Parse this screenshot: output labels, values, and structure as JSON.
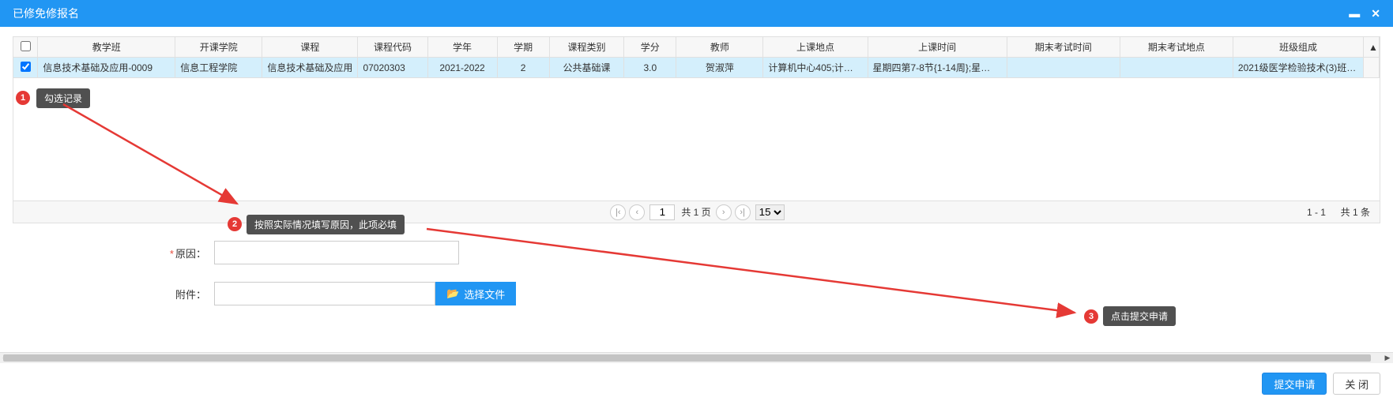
{
  "titlebar": {
    "title": "已修免修报名",
    "minimize_icon": "minimize-icon",
    "close_icon": "close-icon"
  },
  "table": {
    "headers": [
      "",
      "教学班",
      "开课学院",
      "课程",
      "课程代码",
      "学年",
      "学期",
      "课程类别",
      "学分",
      "教师",
      "上课地点",
      "上课时间",
      "期末考试时间",
      "期末考试地点",
      "班级组成"
    ],
    "rows": [
      {
        "checked": true,
        "cells": [
          "信息技术基础及应用-0009",
          "信息工程学院",
          "信息技术基础及应用",
          "07020303",
          "2021-2022",
          "2",
          "公共基础课",
          "3.0",
          "贺淑萍",
          "计算机中心405;计算…",
          "星期四第7-8节{1-14周};星…",
          "",
          "",
          "2021级医学检验技术(3)班…"
        ]
      }
    ]
  },
  "pager": {
    "first_icon": "⏮",
    "prev_icon": "‹",
    "page_value": "1",
    "total_pages_text": "共 1 页",
    "next_icon": "›",
    "last_icon": "⏭",
    "page_size": "15",
    "range_text": "1 - 1",
    "total_text": "共 1 条"
  },
  "form": {
    "reason_required_mark": "*",
    "reason_label": "原因：",
    "reason_value": "",
    "attachment_label": "附件：",
    "attachment_value": "",
    "choose_file_label": "选择文件"
  },
  "annotations": {
    "step1_badge": "1",
    "step1_text": "勾选记录",
    "step2_badge": "2",
    "step2_text": "按照实际情况填写原因，此项必填",
    "step3_badge": "3",
    "step3_text": "点击提交申请"
  },
  "footer": {
    "submit_label": "提交申请",
    "close_label": "关 闭"
  },
  "colors": {
    "primary": "#2196f3",
    "callout_bg": "#505050",
    "badge_bg": "#e53935"
  }
}
